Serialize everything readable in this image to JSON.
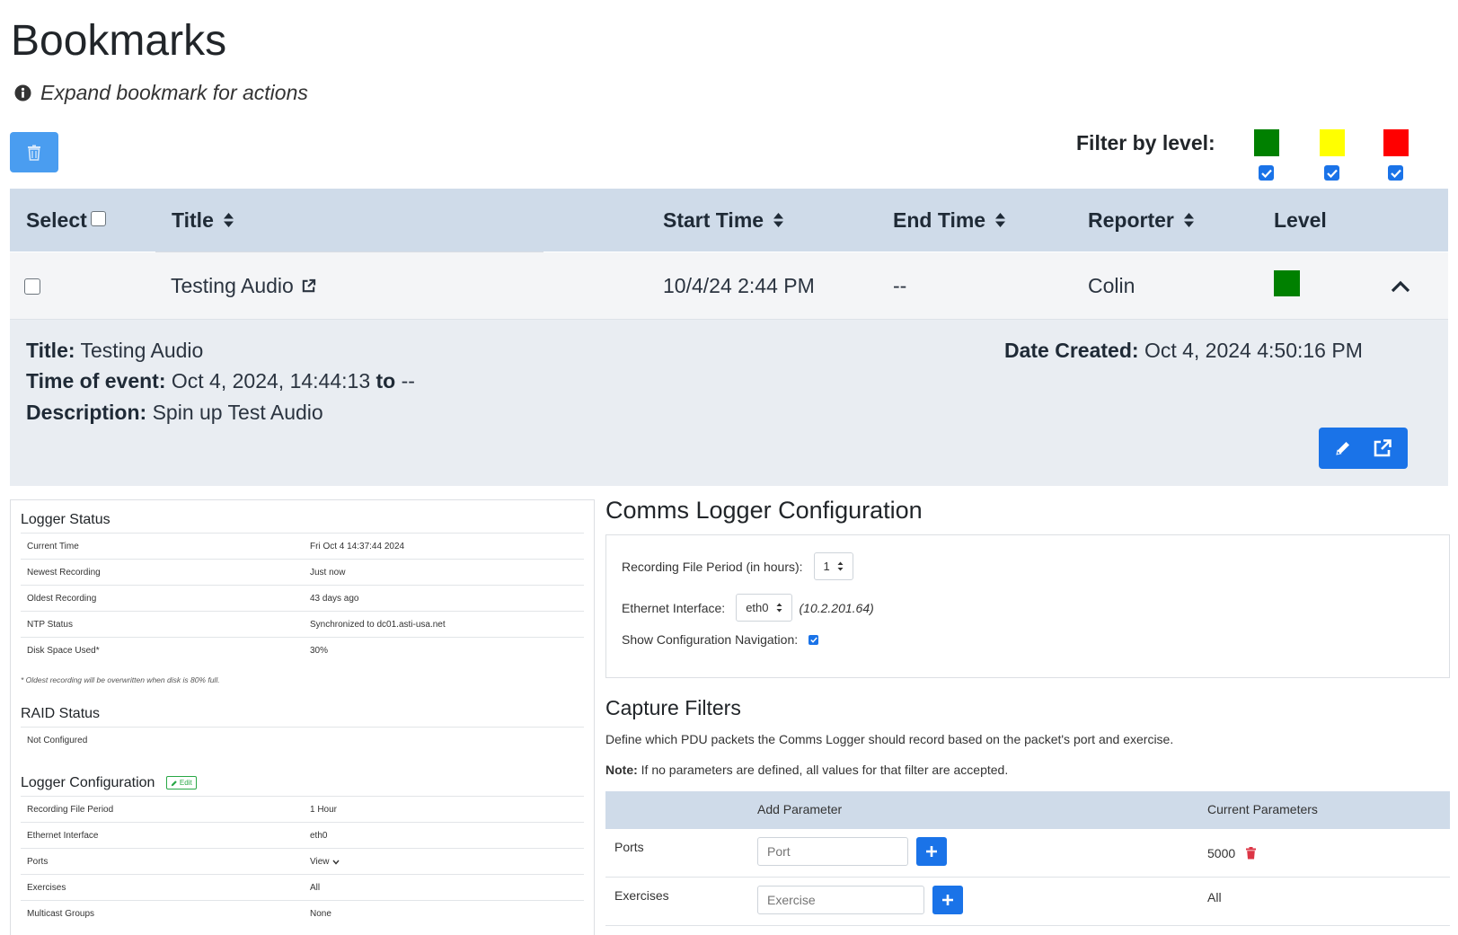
{
  "header": {
    "title": "Bookmarks",
    "hint": "Expand bookmark for actions"
  },
  "filter": {
    "label": "Filter by level:",
    "levels": [
      {
        "color": "#008000",
        "checked": true
      },
      {
        "color": "#ffff00",
        "checked": true
      },
      {
        "color": "#ff0000",
        "checked": true
      }
    ]
  },
  "table": {
    "columns": {
      "select": "Select",
      "title": "Title",
      "start": "Start Time",
      "end": "End Time",
      "reporter": "Reporter",
      "level": "Level"
    },
    "row": {
      "title": "Testing Audio",
      "start": "10/4/24 2:44 PM",
      "end": "--",
      "reporter": "Colin",
      "level_color": "#008000"
    }
  },
  "detail": {
    "title_label": "Title:",
    "title_value": "Testing Audio",
    "time_label": "Time of event:",
    "time_start": "Oct 4, 2024, 14:44:13",
    "time_to": "to",
    "time_end": "--",
    "desc_label": "Description:",
    "desc_value": "Spin up Test Audio",
    "created_label": "Date Created:",
    "created_value": "Oct 4, 2024 4:50:16 PM"
  },
  "logger_status": {
    "title": "Logger Status",
    "rows": [
      {
        "key": "Current Time",
        "value": "Fri Oct 4 14:37:44 2024"
      },
      {
        "key": "Newest Recording",
        "value": "Just now"
      },
      {
        "key": "Oldest Recording",
        "value": "43 days ago"
      },
      {
        "key": "NTP Status",
        "value": "Synchronized to dc01.asti-usa.net"
      },
      {
        "key": "Disk Space Used*",
        "value": "30%"
      }
    ],
    "note": "* Oldest recording will be overwritten when disk is 80% full."
  },
  "raid_status": {
    "title": "RAID Status",
    "value": "Not Configured"
  },
  "logger_config": {
    "title": "Logger Configuration",
    "edit_label": "Edit",
    "rows": [
      {
        "key": "Recording File Period",
        "value": "1 Hour"
      },
      {
        "key": "Ethernet Interface",
        "value": "eth0"
      },
      {
        "key": "Ports",
        "value": "View"
      },
      {
        "key": "Exercises",
        "value": "All"
      },
      {
        "key": "Multicast Groups",
        "value": "None"
      }
    ]
  },
  "comms_config": {
    "title": "Comms Logger Configuration",
    "period_label": "Recording File Period (in hours):",
    "period_value": "1",
    "iface_label": "Ethernet Interface:",
    "iface_value": "eth0",
    "iface_ip": "(10.2.201.64)",
    "nav_label": "Show Configuration Navigation:"
  },
  "capture_filters": {
    "title": "Capture Filters",
    "description": "Define which PDU packets the Comms Logger should record based on the packet's port and exercise.",
    "note_label": "Note:",
    "note_text": "If no parameters are defined, all values for that filter are accepted.",
    "col_add": "Add Parameter",
    "col_current": "Current Parameters",
    "rows": [
      {
        "label": "Ports",
        "placeholder": "Port",
        "current": "5000"
      },
      {
        "label": "Exercises",
        "placeholder": "Exercise",
        "current": "All"
      }
    ]
  }
}
